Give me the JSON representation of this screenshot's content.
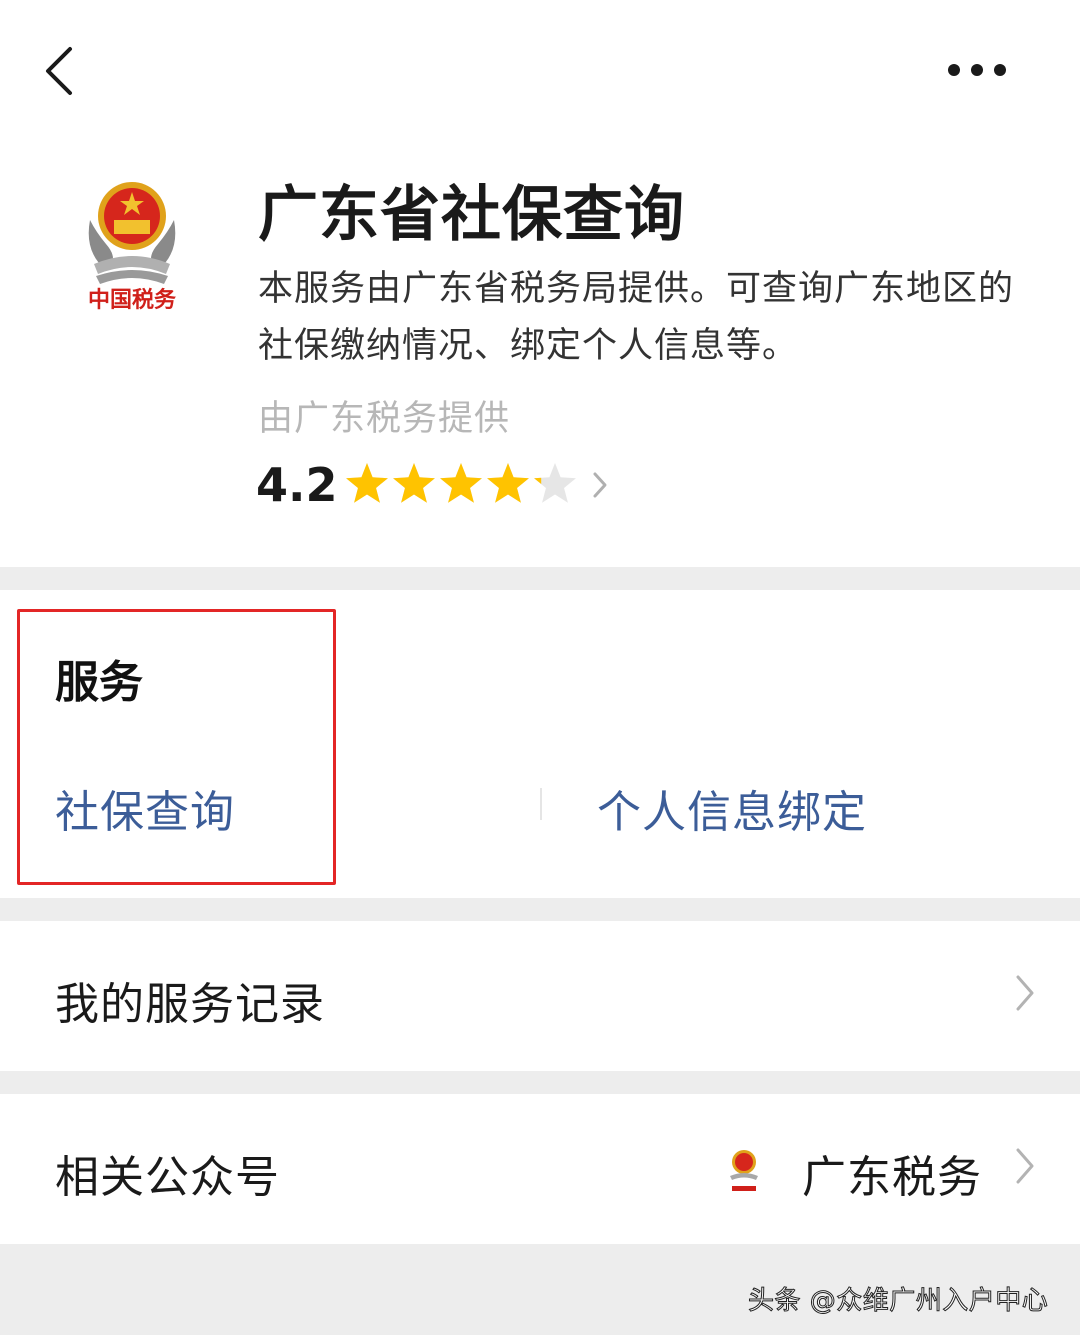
{
  "header": {
    "back_icon": "chevron-left-icon",
    "more_icon": "more-dots-icon"
  },
  "app": {
    "title": "广东省社保查询",
    "description": "本服务由广东省税务局提供。可查询广东地区的社保缴纳情况、绑定个人信息等。",
    "provider": "由广东税务提供",
    "logo_text": "中国税务",
    "rating": "4.2",
    "rating_value": 4.2,
    "rating_max": 5,
    "star_color": "#ffc300"
  },
  "services": {
    "heading": "服务",
    "items": [
      {
        "label": "社保查询"
      },
      {
        "label": "个人信息绑定"
      }
    ],
    "link_color": "#3c5d98",
    "highlight_color": "#e32626"
  },
  "records": {
    "label": "我的服务记录"
  },
  "official_account": {
    "label": "相关公众号",
    "name": "广东税务"
  },
  "watermark": "头条 @众维广州入户中心"
}
